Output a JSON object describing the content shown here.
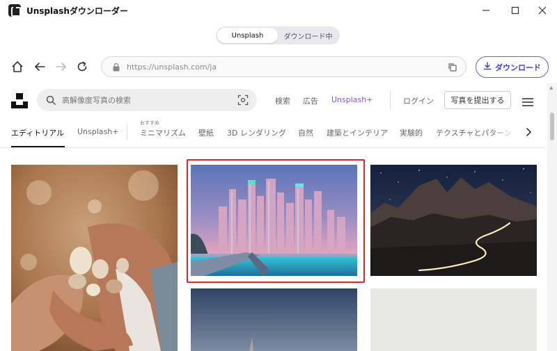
{
  "window": {
    "title": "Unsplashダウンローダー",
    "minimize_icon": "minimize-icon",
    "maximize_icon": "maximize-icon",
    "close_icon": "close-icon"
  },
  "mode_tabs": [
    {
      "label": "Unsplash",
      "active": true
    },
    {
      "label": "ダウンロード中",
      "active": false
    }
  ],
  "browser": {
    "url": "https://unsplash.com/ja",
    "download_button": "ダウンロード",
    "accent_color": "#4a4af0"
  },
  "site_header": {
    "search_placeholder": "高解像度写真の検索",
    "links": [
      "検索",
      "広告",
      "Unsplash+"
    ],
    "login": "ログイン",
    "submit_photo": "写真を提出する"
  },
  "categories": {
    "items": [
      "エディトリアル",
      "Unsplash+",
      "ミニマリズム",
      "壁紙",
      "3D レンダリング",
      "自然",
      "建築とインテリア",
      "実験的",
      "テクスチャとパターン"
    ],
    "active": "エディトリアル",
    "recommended_label": "おすすめ"
  },
  "photos": [
    {
      "subject": "hands holding seashells"
    },
    {
      "subject": "city skyline at night",
      "highlighted": true
    },
    {
      "subject": "mountains with light trail under starry sky"
    },
    {
      "subject": "dusk sky"
    },
    {
      "subject": "pale sky"
    }
  ],
  "highlight_color": "#e12424"
}
